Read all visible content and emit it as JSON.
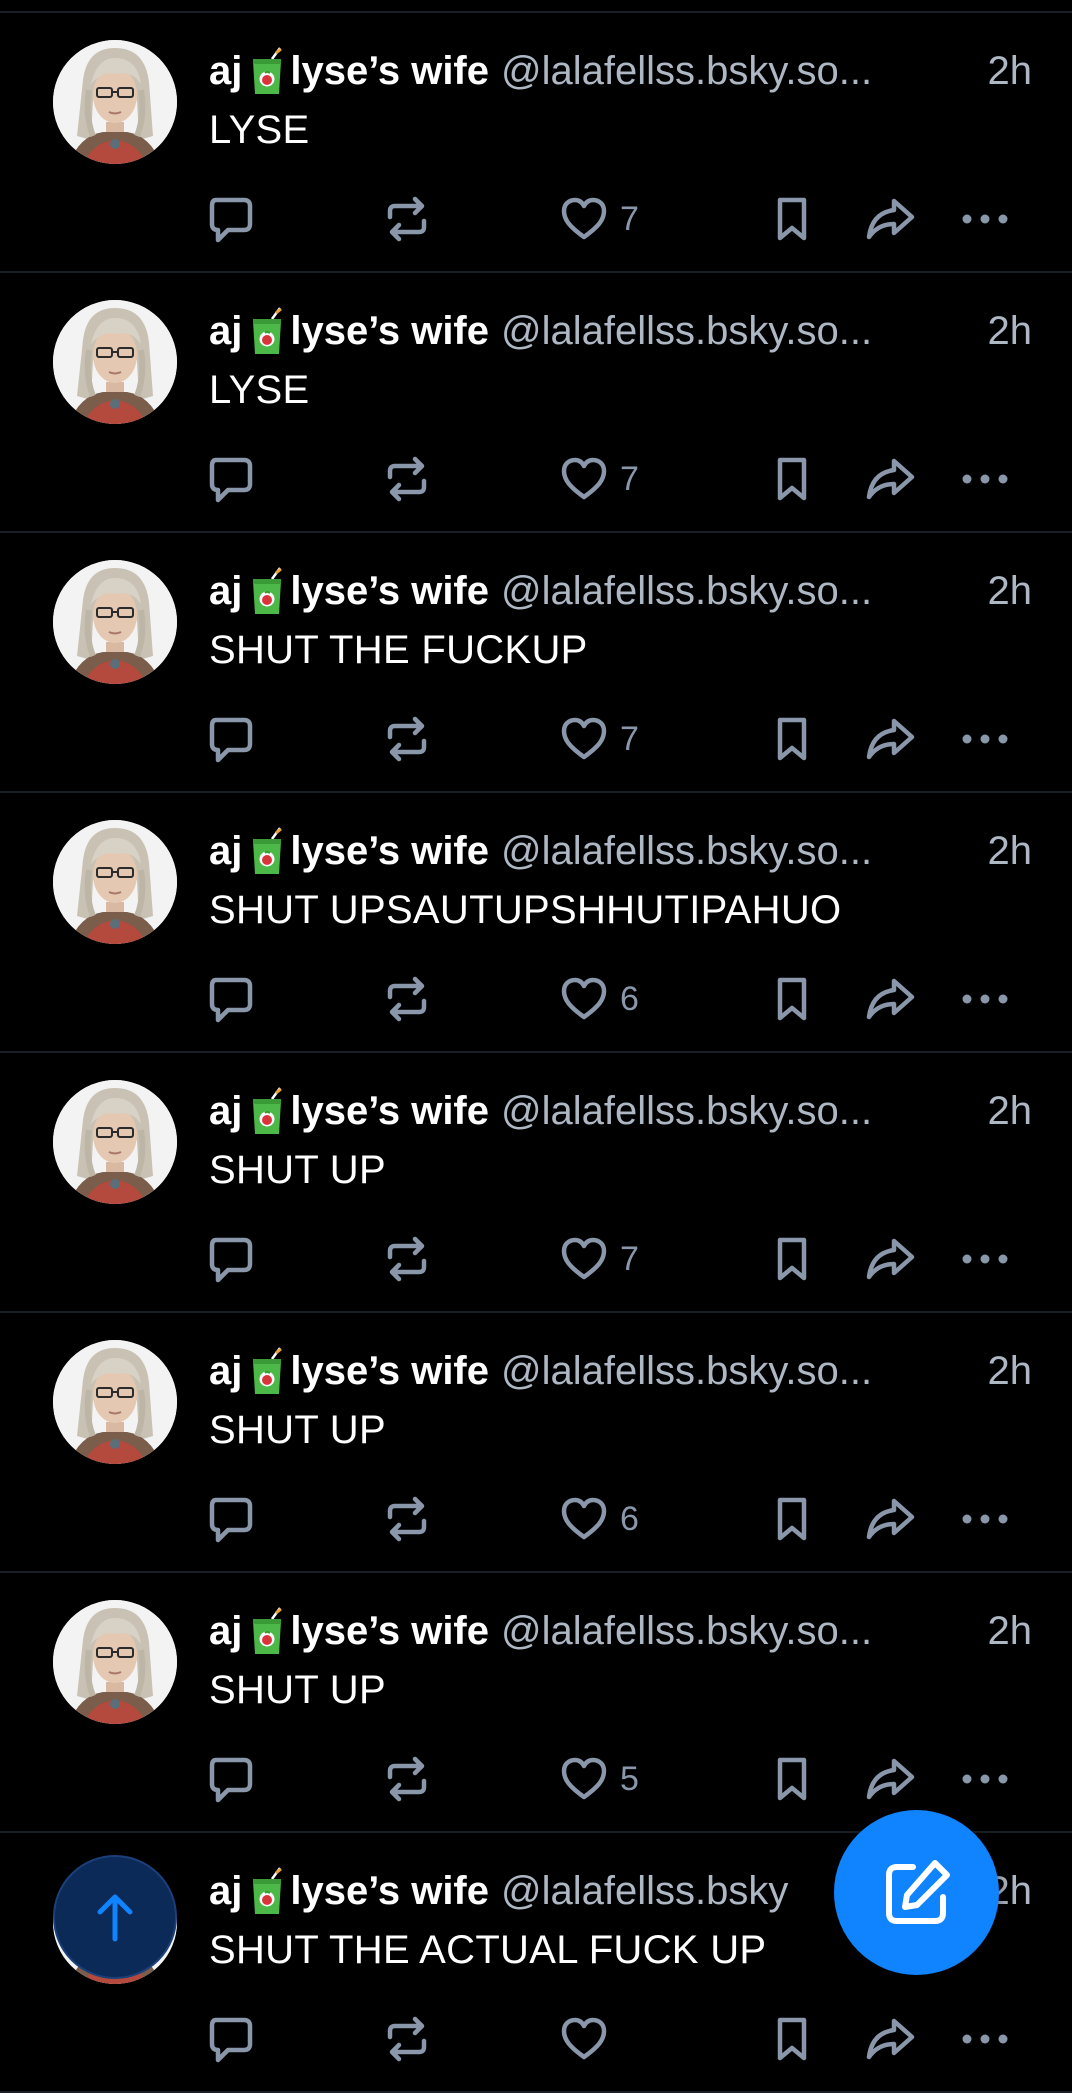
{
  "colors": {
    "background": "#000000",
    "divider": "#1a1f26",
    "secondary_text": "#aeb7c4",
    "icon": "#8a97ab",
    "accent": "#1083fe"
  },
  "posts": [
    {
      "display_name_before": "aj",
      "name_emoji": "juice-box-emoji",
      "display_name_after": "lyse’s wife",
      "handle": "@lalafellss.bsky.so...",
      "time": "2h",
      "text": "LYSE",
      "likes": "7"
    },
    {
      "display_name_before": "aj",
      "name_emoji": "juice-box-emoji",
      "display_name_after": "lyse’s wife",
      "handle": "@lalafellss.bsky.so...",
      "time": "2h",
      "text": "LYSE",
      "likes": "7"
    },
    {
      "display_name_before": "aj",
      "name_emoji": "juice-box-emoji",
      "display_name_after": "lyse’s wife",
      "handle": "@lalafellss.bsky.so...",
      "time": "2h",
      "text": "SHUT THE FUCKUP",
      "likes": "7"
    },
    {
      "display_name_before": "aj",
      "name_emoji": "juice-box-emoji",
      "display_name_after": "lyse’s wife",
      "handle": "@lalafellss.bsky.so...",
      "time": "2h",
      "text": "SHUT UPSAUTUPSHHUTIPAHUO",
      "likes": "6"
    },
    {
      "display_name_before": "aj",
      "name_emoji": "juice-box-emoji",
      "display_name_after": "lyse’s wife",
      "handle": "@lalafellss.bsky.so...",
      "time": "2h",
      "text": "SHUT UP",
      "likes": "7"
    },
    {
      "display_name_before": "aj",
      "name_emoji": "juice-box-emoji",
      "display_name_after": "lyse’s wife",
      "handle": "@lalafellss.bsky.so...",
      "time": "2h",
      "text": "SHUT UP",
      "likes": "6"
    },
    {
      "display_name_before": "aj",
      "name_emoji": "juice-box-emoji",
      "display_name_after": "lyse’s wife",
      "handle": "@lalafellss.bsky.so...",
      "time": "2h",
      "text": "SHUT UP",
      "likes": "5"
    },
    {
      "display_name_before": "aj",
      "name_emoji": "juice-box-emoji",
      "display_name_after": "lyse’s wife",
      "handle": "@lalafellss.bsky",
      "time": "2h",
      "text": "SHUT THE ACTUAL FUCK UP",
      "likes": ""
    }
  ],
  "icons": {
    "reply": "reply-icon",
    "repost": "repost-icon",
    "like": "heart-icon",
    "bookmark": "bookmark-icon",
    "share": "share-icon",
    "more": "more-icon",
    "compose": "compose-icon",
    "scroll_top": "arrow-up-icon"
  }
}
